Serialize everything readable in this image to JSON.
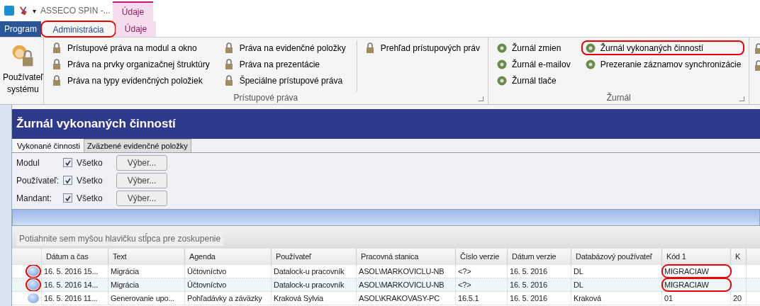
{
  "window": {
    "title": "ASSECO SPIN -...",
    "quick_access_caret": "▾",
    "context_group": "Údaje"
  },
  "ribbon_tabs": [
    {
      "label": "Program",
      "kind": "file",
      "selected": false,
      "highlighted": false
    },
    {
      "label": "Administrácia",
      "kind": "tab",
      "selected": true,
      "highlighted": true
    },
    {
      "label": "Údaje",
      "kind": "context",
      "selected": false,
      "highlighted": false
    }
  ],
  "ribbon": {
    "big_button": {
      "label": "Používateľ systému"
    },
    "groups": [
      {
        "label": "Prístupové práva",
        "columns": [
          [
            {
              "label": "Prístupové práva na modul a okno",
              "highlighted": false
            },
            {
              "label": "Práva na prvky organizačnej štruktúry",
              "highlighted": false
            },
            {
              "label": "Práva na typy evidenčných položiek",
              "highlighted": false
            }
          ],
          [
            {
              "label": "Práva na evidenčné položky",
              "highlighted": false
            },
            {
              "label": "Práva na prezentácie",
              "highlighted": false
            },
            {
              "label": "Špeciálne prístupové práva",
              "highlighted": false
            }
          ],
          [
            {
              "label": "Prehľad prístupových práv",
              "highlighted": false
            }
          ]
        ]
      },
      {
        "label": "Žurnál",
        "columns": [
          [
            {
              "label": "Žurnál zmien",
              "highlighted": false
            },
            {
              "label": "Žurnál e-mailov",
              "highlighted": false
            },
            {
              "label": "Žurnál tlače",
              "highlighted": false
            }
          ],
          [
            {
              "label": "Žurnál vykonaných činností",
              "highlighted": true
            },
            {
              "label": "Prezeranie záznamov synchronizácie",
              "highlighted": false
            }
          ]
        ]
      }
    ]
  },
  "panel": {
    "title": "Žurnál vykonaných činností",
    "tabs": [
      {
        "label": "Vykonané činnosti",
        "selected": true
      },
      {
        "label": "Zväzbené evidenčné položky",
        "selected": false
      }
    ],
    "filters": [
      {
        "label": "Modul",
        "checkbox": "Všetko",
        "checked": true,
        "button": "Výber..."
      },
      {
        "label": "Používateľ:",
        "checkbox": "Všetko",
        "checked": true,
        "button": "Výber..."
      },
      {
        "label": "Mandant:",
        "checkbox": "Všetko",
        "checked": true,
        "button": "Výber..."
      }
    ],
    "group_hint": "Potiahnite sem myšou hlavičku stĺpca pre zoskupenie"
  },
  "table": {
    "columns": [
      "Dátum a čas",
      "Text",
      "Agenda",
      "Používateľ",
      "Pracovná stanica",
      "Číslo verzie",
      "Dátum verzie",
      "Databázový používateľ",
      "Kód 1",
      "K"
    ],
    "rows": [
      {
        "icon_highlighted": true,
        "code_highlighted": true,
        "cells": [
          "16. 5. 2016 15...",
          "Migrácia",
          "Účtovníctvo",
          "Datalock-u pracovník",
          "ASOL\\MARKOVICLU-NB",
          "<?>",
          "16. 5. 2016",
          "DL",
          "MIGRACIAW",
          ""
        ]
      },
      {
        "icon_highlighted": true,
        "code_highlighted": true,
        "cells": [
          "16. 5. 2016 14...",
          "Migrácia",
          "Účtovníctvo",
          "Datalock-u pracovník",
          "ASOL\\MARKOVICLU-NB",
          "<?>",
          "16. 5. 2016",
          "DL",
          "MIGRACIAW",
          ""
        ]
      },
      {
        "icon_highlighted": false,
        "code_highlighted": false,
        "cells": [
          "16. 5. 2016 11...",
          "Generovanie upo...",
          "Pohľadávky a záväzky",
          "Kraková Sylvia",
          "ASOL\\KRAKOVASY-PC",
          "16.5.1",
          "16. 5. 2016",
          "Kraková",
          "01",
          "20"
        ]
      }
    ]
  }
}
